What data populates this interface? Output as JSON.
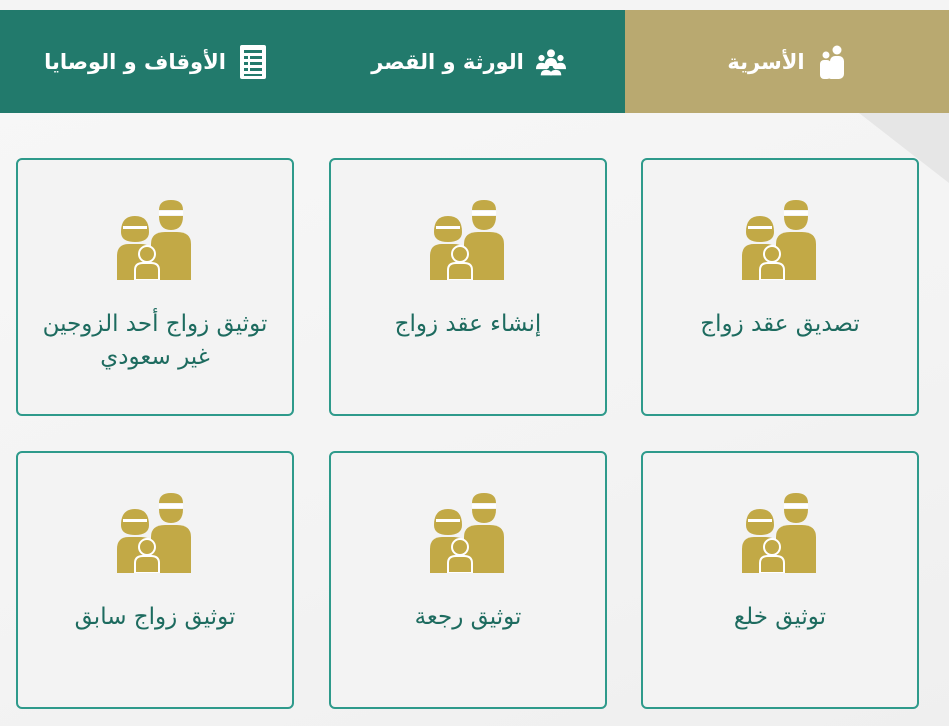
{
  "tabs": [
    {
      "key": "family",
      "label": "الأسرية",
      "icon": "family-members-icon",
      "active": true
    },
    {
      "key": "warathah",
      "label": "الورثة و القصر",
      "icon": "group-people-icon",
      "active": false
    },
    {
      "key": "awqaf",
      "label": "الأوقاف و الوصايا",
      "icon": "document-list-icon",
      "active": false
    }
  ],
  "cards": [
    {
      "label": "تصديق عقد زواج",
      "icon": "family-icon"
    },
    {
      "label": "إنشاء عقد زواج",
      "icon": "family-icon"
    },
    {
      "label": "توثيق زواج أحد الزوجين غير سعودي",
      "icon": "family-icon"
    },
    {
      "label": "توثيق خلع",
      "icon": "family-icon"
    },
    {
      "label": "توثيق رجعة",
      "icon": "family-icon"
    },
    {
      "label": "توثيق زواج سابق",
      "icon": "family-icon"
    }
  ],
  "colors": {
    "tab_teal": "#227a6c",
    "tab_gold": "#b9a970",
    "card_border": "#2e9a8b",
    "icon_gold": "#c2a946",
    "label_text": "#1d6b5f"
  }
}
